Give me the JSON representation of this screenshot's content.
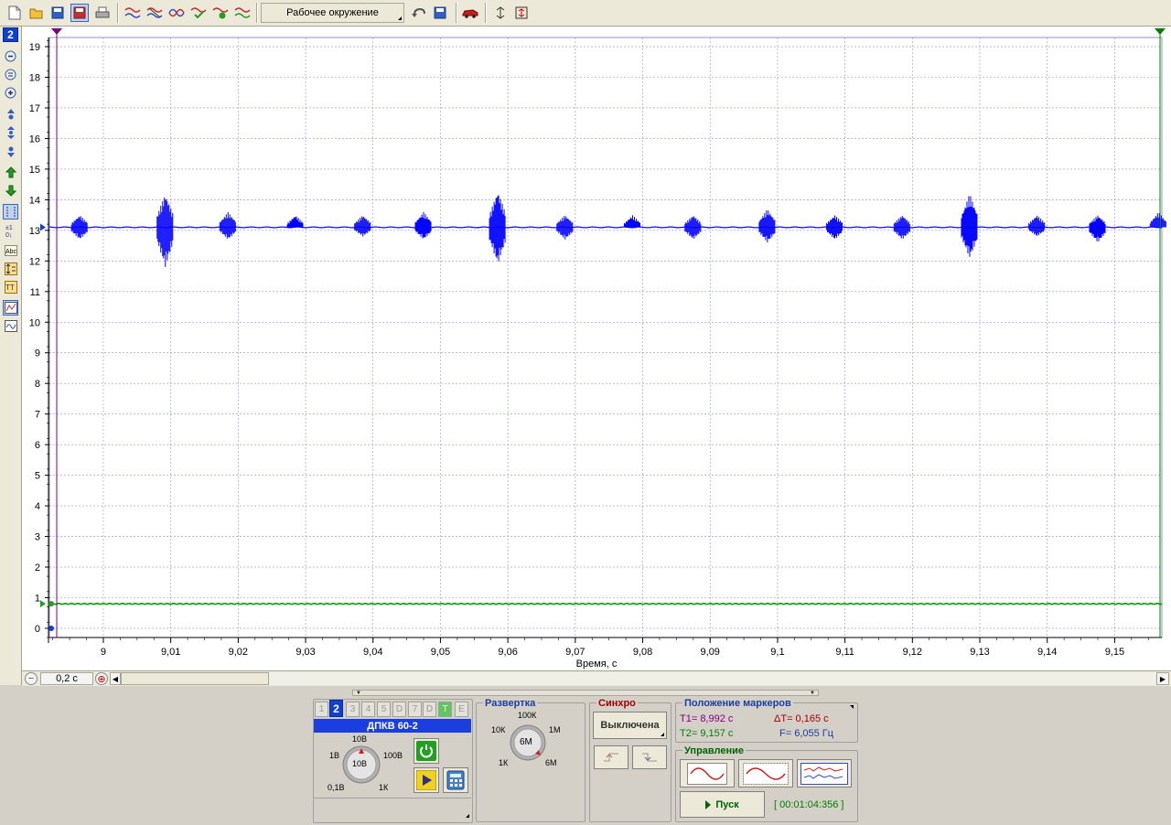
{
  "toolbar": {
    "environment_label": "Рабочее окружение",
    "icons": [
      "new-file",
      "open-folder",
      "save",
      "save-as",
      "print",
      "waves",
      "waves-crossed",
      "waves-sine",
      "waves-check",
      "waves-add",
      "waves-ok",
      "environment",
      "undo",
      "save-env",
      "car",
      "auto-scale",
      "fit-vertical"
    ]
  },
  "left_toolbar": {
    "channel_badge": "2",
    "icons": [
      "zoom-out",
      "zoom-fit",
      "zoom-in",
      "shift-up",
      "shift-center",
      "shift-down",
      "arrow-up",
      "arrow-down",
      "cursor-mode",
      "measure-mode",
      "text-mode",
      "scale-mode",
      "tt-mode",
      "graph-mode",
      "wave-mode"
    ]
  },
  "plot": {
    "xlabel": "Время, с",
    "background": "#ffffff",
    "grid_color": "#9090d8",
    "y_ticks": [
      "0",
      "1",
      "2",
      "3",
      "4",
      "5",
      "6",
      "7",
      "8",
      "9",
      "10",
      "11",
      "12",
      "13",
      "14",
      "15",
      "16",
      "17",
      "18",
      "19"
    ],
    "x_ticks": [
      "9",
      "9,01",
      "9,02",
      "9,03",
      "9,04",
      "9,05",
      "9,06",
      "9,07",
      "9,08",
      "9,09",
      "9,1",
      "9,11",
      "9,12",
      "9,13",
      "9,14",
      "9,15"
    ],
    "markers": {
      "t1_color": "#800080",
      "t2_color": "#008000"
    }
  },
  "chart_data": {
    "type": "line",
    "title": "",
    "xlabel": "Время, с",
    "ylabel": "",
    "xlim": [
      8.992,
      9.157
    ],
    "ylim": [
      -0.3,
      19.3
    ],
    "grid": true,
    "series": [
      {
        "color": "#0000ff",
        "baseline": 13.1,
        "bursts": [
          {
            "x": 8.9965,
            "min": 12.7,
            "max": 13.5
          },
          {
            "x": 9.0092,
            "min": 11.8,
            "max": 14.2
          },
          {
            "x": 9.0185,
            "min": 12.7,
            "max": 13.6
          },
          {
            "x": 9.0285,
            "min": 13.1,
            "max": 13.5
          },
          {
            "x": 9.0385,
            "min": 12.8,
            "max": 13.5
          },
          {
            "x": 9.0475,
            "min": 12.7,
            "max": 13.6
          },
          {
            "x": 9.0585,
            "min": 11.9,
            "max": 14.3
          },
          {
            "x": 9.0685,
            "min": 12.7,
            "max": 13.5
          },
          {
            "x": 9.0785,
            "min": 13.1,
            "max": 13.5
          },
          {
            "x": 9.0875,
            "min": 12.7,
            "max": 13.5
          },
          {
            "x": 9.0985,
            "min": 12.6,
            "max": 13.7
          },
          {
            "x": 9.1085,
            "min": 12.7,
            "max": 13.5
          },
          {
            "x": 9.1185,
            "min": 12.7,
            "max": 13.5
          },
          {
            "x": 9.1285,
            "min": 12.1,
            "max": 14.2
          },
          {
            "x": 9.1385,
            "min": 12.8,
            "max": 13.5
          },
          {
            "x": 9.1475,
            "min": 12.6,
            "max": 13.5
          },
          {
            "x": 9.1565,
            "min": 13.1,
            "max": 13.6
          }
        ]
      },
      {
        "color": "#00a000",
        "baseline": 0.8,
        "bursts": []
      }
    ]
  },
  "hscroll": {
    "scale_value": "0,2 с"
  },
  "channel_panel": {
    "tabs": [
      "1",
      "2",
      "3",
      "4",
      "5",
      "D",
      "7",
      "D",
      "T",
      "E"
    ],
    "active_tab": "2",
    "sensor_name": "ДПКВ 60-2",
    "knob_center": "10В",
    "knob_labels": {
      "top": "10В",
      "left_top": "1В",
      "right_top": "100В",
      "left_bottom": "0,1В",
      "right_bottom": "1К"
    }
  },
  "sweep_panel": {
    "title": "Развертка",
    "knob_center": "6М",
    "labels": {
      "top": "100К",
      "left_top": "10К",
      "right_top": "1М",
      "left_bottom": "1К",
      "right_bottom": "6М"
    }
  },
  "sync_panel": {
    "title": "Синхро",
    "mode_label": "Выключена"
  },
  "markers_panel": {
    "title": "Положение маркеров",
    "t1": "T1= 8,992 с",
    "t2": "T2= 9,157 с",
    "dt": "ΔT= 0,165 с",
    "f": "F= 6,055 Гц"
  },
  "control_panel": {
    "title": "Управление",
    "start_label": "Пуск",
    "timer": "[ 00:01:04:356 ]"
  }
}
